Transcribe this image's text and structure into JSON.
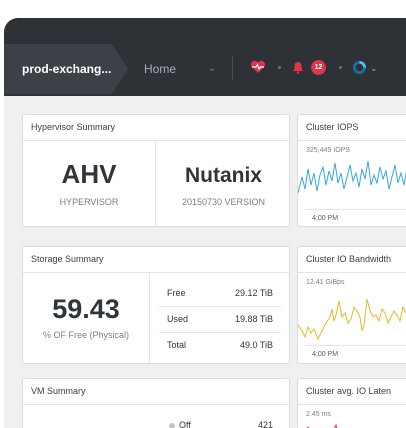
{
  "header": {
    "cluster_name": "prod-exchang...",
    "home_label": "Home",
    "alert_count": "12"
  },
  "hypervisor_summary": {
    "title": "Hypervisor Summary",
    "hypervisor_value": "AHV",
    "hypervisor_label": "HYPERVISOR",
    "version_value": "Nutanix",
    "version_label": "20150730 VERSION"
  },
  "storage_summary": {
    "title": "Storage Summary",
    "percent": "59.43",
    "percent_label": "% OF Free (Physical)",
    "rows": [
      {
        "label": "Free",
        "value": "29.12 TiB"
      },
      {
        "label": "Used",
        "value": "19.88 TiB"
      },
      {
        "label": "Total",
        "value": "49.0 TiB"
      }
    ]
  },
  "vm_summary": {
    "title": "VM Summary",
    "rows": [
      {
        "label": "Off",
        "value": "421"
      }
    ]
  },
  "cluster_iops": {
    "title": "Cluster IOPS",
    "peak": "325,449 IOPS",
    "time": "4:00 PM"
  },
  "cluster_bandwidth": {
    "title": "Cluster IO Bandwidth",
    "peak": "12.41 GiBps",
    "time": "4:00 PM"
  },
  "cluster_latency": {
    "title": "Cluster avg. IO Laten",
    "peak": "2.45 ms"
  },
  "colors": {
    "topbar": "#2e3136",
    "iops_line": "#3aa6dd",
    "bandwidth_line": "#e7b92b",
    "latency_line": "#e0334d",
    "alert": "#e0334d"
  }
}
